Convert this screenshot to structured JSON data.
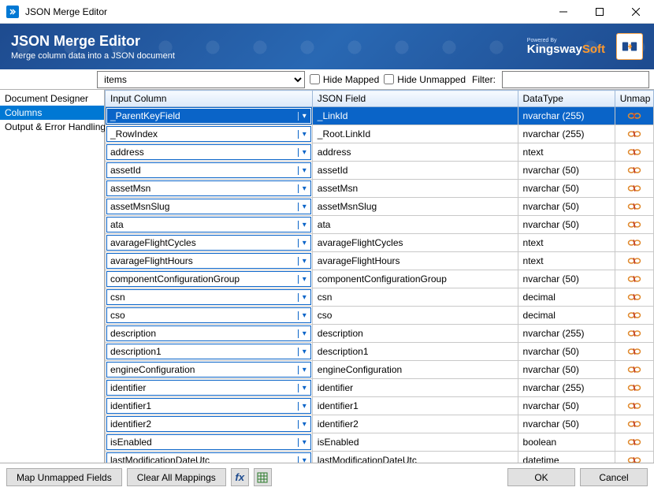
{
  "window": {
    "title": "JSON Merge Editor",
    "banner_title": "JSON Merge Editor",
    "banner_subtitle": "Merge column data into a JSON document",
    "brand_powered": "Powered By",
    "brand_name_left": "Kingsway",
    "brand_name_right": "Soft"
  },
  "sidebar": {
    "items": [
      {
        "label": "Document Designer"
      },
      {
        "label": "Columns"
      },
      {
        "label": "Output & Error Handling"
      }
    ],
    "selected_index": 1
  },
  "topbar": {
    "section_value": "items",
    "hide_mapped_label": "Hide Mapped",
    "hide_unmapped_label": "Hide Unmapped",
    "filter_label": "Filter:",
    "filter_value": ""
  },
  "columns": {
    "headers": {
      "input": "Input Column",
      "json": "JSON Field",
      "type": "DataType",
      "unmap": "Unmap"
    },
    "rows": [
      {
        "input": "_ParentKeyField",
        "json": "_LinkId",
        "type": "nvarchar (255)",
        "selected": true
      },
      {
        "input": "_RowIndex",
        "json": "_Root.LinkId",
        "type": "nvarchar (255)"
      },
      {
        "input": "address",
        "json": "address",
        "type": "ntext"
      },
      {
        "input": "assetId",
        "json": "assetId",
        "type": "nvarchar (50)"
      },
      {
        "input": "assetMsn",
        "json": "assetMsn",
        "type": "nvarchar (50)"
      },
      {
        "input": "assetMsnSlug",
        "json": "assetMsnSlug",
        "type": "nvarchar (50)"
      },
      {
        "input": "ata",
        "json": "ata",
        "type": "nvarchar (50)"
      },
      {
        "input": "avarageFlightCycles",
        "json": "avarageFlightCycles",
        "type": "ntext"
      },
      {
        "input": "avarageFlightHours",
        "json": "avarageFlightHours",
        "type": "ntext"
      },
      {
        "input": "componentConfigurationGroup",
        "json": "componentConfigurationGroup",
        "type": "nvarchar (50)"
      },
      {
        "input": "csn",
        "json": "csn",
        "type": "decimal"
      },
      {
        "input": "cso",
        "json": "cso",
        "type": "decimal"
      },
      {
        "input": "description",
        "json": "description",
        "type": "nvarchar (255)"
      },
      {
        "input": "description1",
        "json": "description1",
        "type": "nvarchar (50)"
      },
      {
        "input": "engineConfiguration",
        "json": "engineConfiguration",
        "type": "nvarchar (50)"
      },
      {
        "input": "identifier",
        "json": "identifier",
        "type": "nvarchar (255)"
      },
      {
        "input": "identifier1",
        "json": "identifier1",
        "type": "nvarchar (50)"
      },
      {
        "input": "identifier2",
        "json": "identifier2",
        "type": "nvarchar (50)"
      },
      {
        "input": "isEnabled",
        "json": "isEnabled",
        "type": "boolean"
      },
      {
        "input": "lastModificationDateUtc",
        "json": "lastModificationDateUtc",
        "type": "datetime"
      }
    ]
  },
  "footer": {
    "map_unmapped": "Map Unmapped Fields",
    "clear_all": "Clear All Mappings",
    "ok": "OK",
    "cancel": "Cancel"
  }
}
